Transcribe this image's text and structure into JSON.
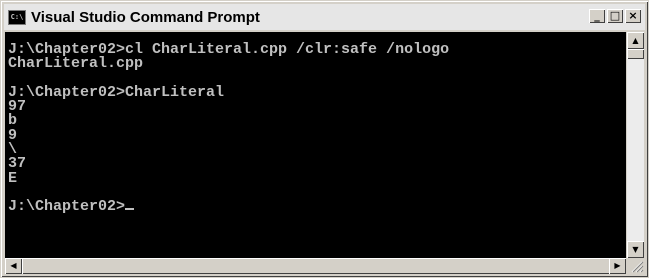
{
  "window": {
    "title": "Visual Studio Command Prompt",
    "icon": "console-icon",
    "icon_text": "C:\\",
    "controls": {
      "minimize": "_",
      "maximize": "□",
      "close": "×"
    }
  },
  "console": {
    "lines": [
      "J:\\Chapter02>cl CharLiteral.cpp /clr:safe /nologo",
      "CharLiteral.cpp",
      "",
      "J:\\Chapter02>CharLiteral",
      "97",
      "b",
      "9",
      "\\",
      "37",
      "E",
      "",
      "J:\\Chapter02>"
    ],
    "colors": {
      "background": "#000000",
      "text": "#c0c0c0"
    }
  },
  "scrollbars": {
    "up_arrow": "▲",
    "down_arrow": "▼",
    "left_arrow": "◀",
    "right_arrow": "▶"
  }
}
